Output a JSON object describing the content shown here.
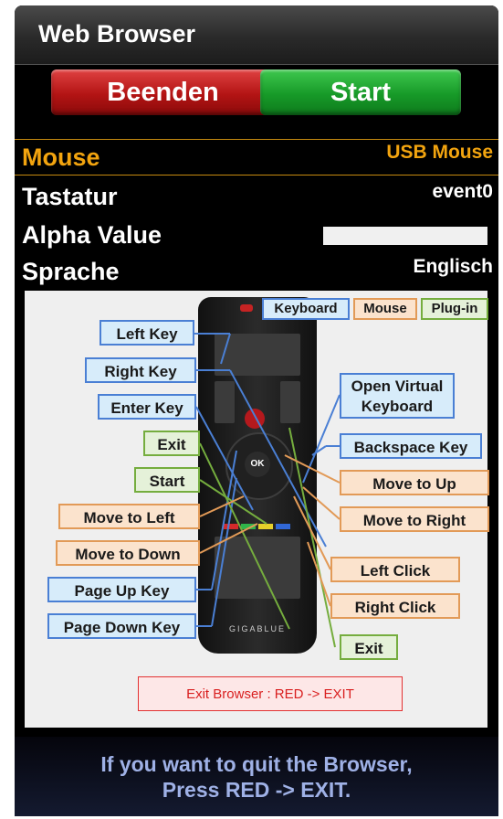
{
  "window": {
    "title": "Web Browser"
  },
  "buttons": {
    "red_label": "Beenden",
    "green_label": "Start"
  },
  "settings": [
    {
      "label": "Mouse",
      "value": "USB Mouse"
    },
    {
      "label": "Tastatur",
      "value": "event0"
    },
    {
      "label": "Alpha Value",
      "value": ""
    },
    {
      "label": "Sprache",
      "value": "Englisch"
    }
  ],
  "diagram": {
    "tabs": [
      "Keyboard",
      "Mouse",
      "Plug-in"
    ],
    "remote_brand": "GIGABLUE",
    "remote_ok": "OK",
    "left_labels": [
      "Left Key",
      "Right Key",
      "Enter Key",
      "Exit",
      "Start",
      "Move to Left",
      "Move to Down",
      "Page Up Key",
      "Page Down Key"
    ],
    "right_labels": [
      "Open Virtual Keyboard",
      "Backspace Key",
      "Move to Up",
      "Move to Right",
      "Left Click",
      "Right Click",
      "Exit"
    ],
    "exit_hint": "Exit Browser : RED -> EXIT"
  },
  "footer": {
    "text": "If you want to quit the Browser,\nPress RED -> EXIT."
  },
  "colors": {
    "accent_orange": "#f2a40f",
    "keyboard_blue": "#4a7fd4",
    "mouse_orange": "#e29a57",
    "plugin_green": "#75ad3e",
    "exit_red": "#d91f1f"
  }
}
